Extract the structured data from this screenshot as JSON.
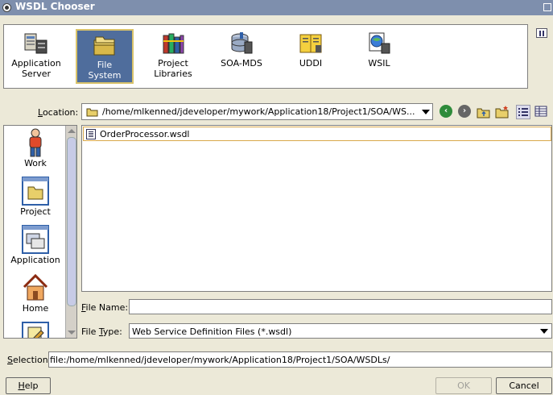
{
  "window": {
    "title": "WSDL Chooser"
  },
  "sources": [
    {
      "label_line1": "Application",
      "label_line2": "Server",
      "icon": "application-server-icon"
    },
    {
      "label_line1": "File",
      "label_line2": "System",
      "icon": "file-system-icon",
      "selected": true
    },
    {
      "label_line1": "Project",
      "label_line2": "Libraries",
      "icon": "project-libraries-icon"
    },
    {
      "label_line1": "SOA-MDS",
      "label_line2": "",
      "icon": "soa-mds-icon"
    },
    {
      "label_line1": "UDDI",
      "label_line2": "",
      "icon": "uddi-icon"
    },
    {
      "label_line1": "WSIL",
      "label_line2": "",
      "icon": "wsil-icon"
    }
  ],
  "location": {
    "label_first": "L",
    "label_rest": "ocation:",
    "value": "/home/mlkenned/jdeveloper/mywork/Application18/Project1/SOA/WS..."
  },
  "places": [
    {
      "label": "Work",
      "icon": "work-person-icon"
    },
    {
      "label": "Project",
      "icon": "project-folder-icon"
    },
    {
      "label": "Application",
      "icon": "application-icon"
    },
    {
      "label": "Home",
      "icon": "home-icon"
    }
  ],
  "files": [
    {
      "name": "OrderProcessor.wsdl",
      "icon": "wsdl-file-icon"
    }
  ],
  "file_name": {
    "label_first": "F",
    "label_rest": "ile Name:",
    "value": ""
  },
  "file_type": {
    "label_pre": "File ",
    "label_ul": "T",
    "label_post": "ype:",
    "value": "Web Service Definition Files (*.wsdl)"
  },
  "selection": {
    "label_first": "S",
    "label_rest": "election:",
    "value": "file:/home/mlkenned/jdeveloper/mywork/Application18/Project1/SOA/WSDLs/"
  },
  "buttons": {
    "help_first": "H",
    "help_rest": "elp",
    "ok": "OK",
    "cancel": "Cancel"
  },
  "colors": {
    "titlebar": "#7e8fad",
    "selected_source": "#4f6d9c",
    "selection_border": "#d9a84a"
  }
}
